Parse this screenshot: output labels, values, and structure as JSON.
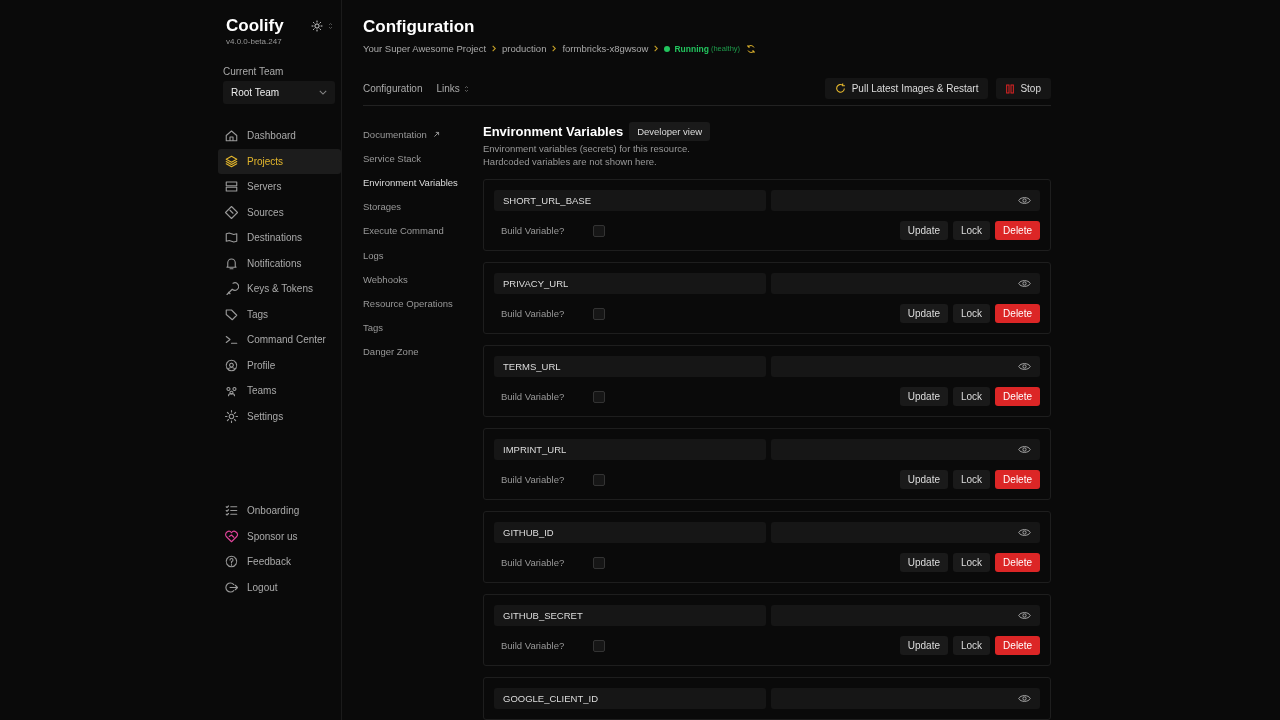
{
  "app": {
    "name": "Coolify",
    "version": "v4.0.0-beta.247"
  },
  "team": {
    "label": "Current Team",
    "value": "Root Team"
  },
  "nav": [
    {
      "label": "Dashboard",
      "selected": false
    },
    {
      "label": "Projects",
      "selected": true
    },
    {
      "label": "Servers",
      "selected": false
    },
    {
      "label": "Sources",
      "selected": false
    },
    {
      "label": "Destinations",
      "selected": false
    },
    {
      "label": "Notifications",
      "selected": false
    },
    {
      "label": "Keys & Tokens",
      "selected": false
    },
    {
      "label": "Tags",
      "selected": false
    },
    {
      "label": "Command Center",
      "selected": false
    },
    {
      "label": "Profile",
      "selected": false
    },
    {
      "label": "Teams",
      "selected": false
    },
    {
      "label": "Settings",
      "selected": false
    }
  ],
  "nav_bottom": [
    {
      "label": "Onboarding"
    },
    {
      "label": "Sponsor us"
    },
    {
      "label": "Feedback"
    },
    {
      "label": "Logout"
    }
  ],
  "page": {
    "title": "Configuration",
    "breadcrumbs": [
      "Your Super Awesome Project",
      "production",
      "formbricks-x8gwsow"
    ],
    "status": {
      "label": "Running",
      "detail": "(healthy)"
    }
  },
  "tabs": [
    {
      "label": "Configuration",
      "kind": "plain"
    },
    {
      "label": "Links",
      "kind": "dropdown"
    }
  ],
  "actions": [
    {
      "label": "Pull Latest Images & Restart",
      "kind": "restart"
    },
    {
      "label": "Stop",
      "kind": "stop"
    }
  ],
  "subnav": [
    {
      "label": "Documentation",
      "selected": false,
      "external": true
    },
    {
      "label": "Service Stack",
      "selected": false,
      "external": false
    },
    {
      "label": "Environment Variables",
      "selected": true,
      "external": false
    },
    {
      "label": "Storages",
      "selected": false,
      "external": false
    },
    {
      "label": "Execute Command",
      "selected": false,
      "external": false
    },
    {
      "label": "Logs",
      "selected": false,
      "external": false
    },
    {
      "label": "Webhooks",
      "selected": false,
      "external": false
    },
    {
      "label": "Resource Operations",
      "selected": false,
      "external": false
    },
    {
      "label": "Tags",
      "selected": false,
      "external": false
    },
    {
      "label": "Danger Zone",
      "selected": false,
      "external": false
    }
  ],
  "env": {
    "title": "Environment Variables",
    "view_button": "Developer view",
    "description": [
      "Environment variables (secrets) for this resource.",
      "Hardcoded variables are not shown here."
    ],
    "variables": [
      {
        "key": "SHORT_URL_BASE",
        "build_label": "Build Variable?",
        "build_variable": false,
        "buttons": [
          "Update",
          "Lock",
          "Delete"
        ]
      },
      {
        "key": "PRIVACY_URL",
        "build_label": "Build Variable?",
        "build_variable": false,
        "buttons": [
          "Update",
          "Lock",
          "Delete"
        ]
      },
      {
        "key": "TERMS_URL",
        "build_label": "Build Variable?",
        "build_variable": false,
        "buttons": [
          "Update",
          "Lock",
          "Delete"
        ]
      },
      {
        "key": "IMPRINT_URL",
        "build_label": "Build Variable?",
        "build_variable": false,
        "buttons": [
          "Update",
          "Lock",
          "Delete"
        ]
      },
      {
        "key": "GITHUB_ID",
        "build_label": "Build Variable?",
        "build_variable": false,
        "buttons": [
          "Update",
          "Lock",
          "Delete"
        ]
      },
      {
        "key": "GITHUB_SECRET",
        "build_label": "Build Variable?",
        "build_variable": false,
        "buttons": [
          "Update",
          "Lock",
          "Delete"
        ]
      },
      {
        "key": "GOOGLE_CLIENT_ID"
      }
    ]
  }
}
